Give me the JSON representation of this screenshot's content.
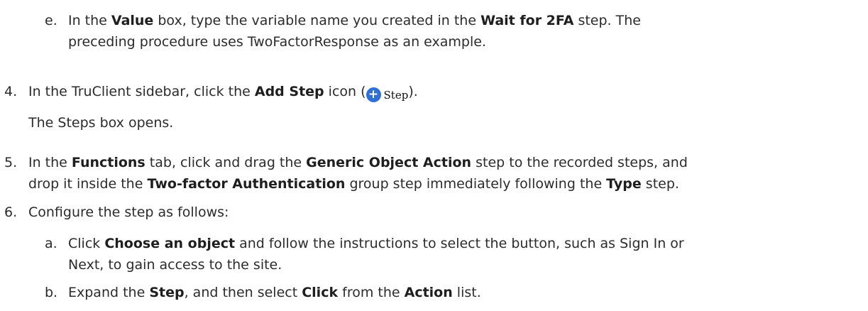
{
  "steps": {
    "e": {
      "marker": "e.",
      "t1": "In the ",
      "b1": "Value",
      "t2": " box, type the variable name you created in the ",
      "b2": "Wait for 2FA",
      "t3": " step. The",
      "line2": "preceding procedure uses TwoFactorResponse as an example."
    },
    "s4": {
      "marker": "4.",
      "t1": "In the TruClient sidebar, click the ",
      "b1": "Add Step",
      "t2": " icon (",
      "icon_label": "Step",
      "t3": ").",
      "line2": "The Steps box opens."
    },
    "s5": {
      "marker": "5.",
      "t1": "In the ",
      "b1": "Functions",
      "t2": " tab, click and drag the ",
      "b2": "Generic Object Action",
      "t3": " step to the recorded steps, and",
      "l2_t1": "drop it inside the ",
      "l2_b1": "Two-factor Authentication",
      "l2_t2": " group step immediately following the ",
      "l2_b2": "Type",
      "l2_t3": " step."
    },
    "s6": {
      "marker": "6.",
      "text": "Configure the step as follows:"
    },
    "a": {
      "marker": "a.",
      "t1": "Click ",
      "b1": "Choose an object",
      "t2": " and follow the instructions to select the button, such as Sign In or",
      "line2": "Next, to gain access to the site."
    },
    "b": {
      "marker": "b.",
      "t1": "Expand the ",
      "b1": "Step",
      "t2": ", and then select ",
      "b2": "Click",
      "t3": " from the ",
      "b3": "Action",
      "t4": " list."
    }
  },
  "colors": {
    "icon_blue": "#2f6fd6",
    "text": "#2b2b2b"
  },
  "icons": {
    "add_step": "plus-circle-icon"
  }
}
